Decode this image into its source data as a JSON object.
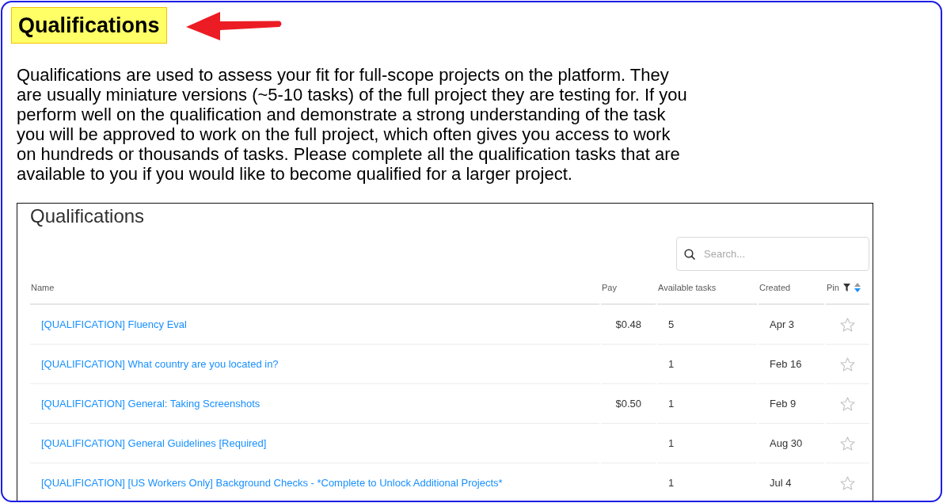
{
  "heading": "Qualifications",
  "intro": "Qualifications are used to assess your fit for full-scope projects on the platform. They are usually miniature versions (~5-10 tasks) of the full project they are testing for. If you perform well on the qualification and demonstrate a strong understanding of the task you will be approved to work on the full project, which often gives you access to work on hundreds or thousands of tasks. Please complete all the qualification tasks that are available to you if you would like to become qualified for a larger project.",
  "panel": {
    "title": "Qualifications",
    "search": {
      "placeholder": "Search..."
    },
    "table": {
      "columns": [
        {
          "label": "Name"
        },
        {
          "label": "Pay"
        },
        {
          "label": "Available tasks"
        },
        {
          "label": "Created"
        },
        {
          "label": "Pin",
          "filterable": true,
          "sorted_descending": true
        }
      ],
      "rows": [
        {
          "name": "[QUALIFICATION] Fluency Eval",
          "pay": "$0.48",
          "available_tasks": "5",
          "created": "Apr 3",
          "pinned": false
        },
        {
          "name": "[QUALIFICATION] What country are you located in?",
          "available_tasks": "1",
          "created": "Feb 16",
          "pinned": false
        },
        {
          "name": "[QUALIFICATION] General: Taking Screenshots",
          "pay": "$0.50",
          "available_tasks": "1",
          "created": "Feb 9",
          "pinned": false
        },
        {
          "name": "[QUALIFICATION] General Guidelines [Required]",
          "available_tasks": "1",
          "created": "Aug 30",
          "pinned": false
        },
        {
          "name": "[QUALIFICATION] [US Workers Only] Background Checks - *Complete to Unlock Additional Projects*",
          "available_tasks": "1",
          "created": "Jul 4",
          "pinned": false
        }
      ]
    }
  }
}
